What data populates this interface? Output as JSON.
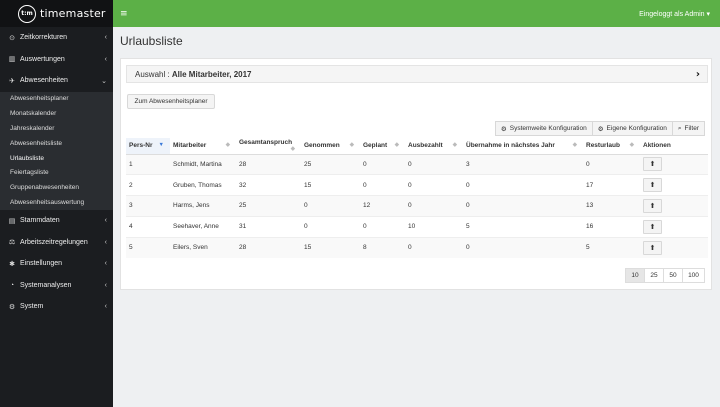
{
  "app": {
    "logo_badge": "t:m",
    "logo_text": "timemaster"
  },
  "topbar": {
    "menu_icon": "hamburger-icon",
    "user_label": "Eingeloggt als Admin",
    "user_caret": "▾"
  },
  "sidebar": {
    "items": [
      {
        "label": "Zeitkorrekturen",
        "icon": "clock-icon"
      },
      {
        "label": "Auswertungen",
        "icon": "bar-chart-icon"
      },
      {
        "label": "Abwesenheiten",
        "icon": "plane-icon"
      },
      {
        "label": "Stammdaten",
        "icon": "database-icon"
      },
      {
        "label": "Arbeitszeitregelungen",
        "icon": "rules-icon"
      },
      {
        "label": "Einstellungen",
        "icon": "gear-icon"
      },
      {
        "label": "Systemanalysen",
        "icon": "dashboard-icon"
      },
      {
        "label": "System",
        "icon": "gears-icon"
      }
    ],
    "submenu": [
      "Abwesenheitsplaner",
      "Monatskalender",
      "Jahreskalender",
      "Abwesenheitsliste",
      "Urlaubsliste",
      "Feiertagsliste",
      "Gruppenabwesenheiten",
      "Abwesenheitsauswertung"
    ]
  },
  "page": {
    "title": "Urlaubsliste"
  },
  "selection": {
    "label": "Auswahl : ",
    "value": "Alle Mitarbeiter, 2017"
  },
  "buttons": {
    "planner": "Zum Abwesenheitsplaner",
    "system_config": "Systemweite Konfiguration",
    "own_config": "Eigene Konfiguration",
    "filter": "Filter"
  },
  "table": {
    "headers": [
      "Pers-Nr",
      "Mitarbeiter",
      "Gesamtanspruch",
      "Genommen",
      "Geplant",
      "Ausbezahlt",
      "Übernahme in nächstes Jahr",
      "Resturlaub",
      "Aktionen"
    ],
    "rows": [
      [
        "1",
        "Schmidt, Martina",
        "28",
        "25",
        "0",
        "0",
        "3",
        "0"
      ],
      [
        "2",
        "Gruben, Thomas",
        "32",
        "15",
        "0",
        "0",
        "0",
        "17"
      ],
      [
        "3",
        "Harms, Jens",
        "25",
        "0",
        "12",
        "0",
        "0",
        "13"
      ],
      [
        "4",
        "Seehaver, Anne",
        "31",
        "0",
        "0",
        "10",
        "5",
        "16"
      ],
      [
        "5",
        "Eilers, Sven",
        "28",
        "15",
        "8",
        "0",
        "0",
        "5"
      ]
    ]
  },
  "pager": [
    "10",
    "25",
    "50",
    "100"
  ]
}
